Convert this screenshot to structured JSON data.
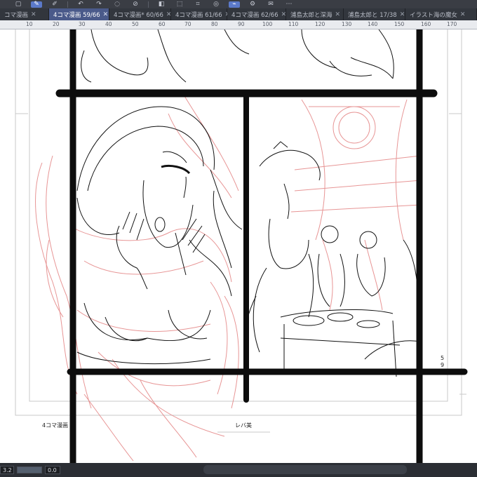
{
  "toolbar": {
    "icons": [
      "select-icon",
      "edit-icon",
      "brush-icon",
      "undo-icon",
      "redo-icon",
      "loading-icon",
      "clear-icon",
      "fill-icon",
      "transform-icon",
      "crop-icon",
      "lasso-icon",
      "deselect-icon",
      "settings-icon",
      "comment-icon",
      "more-icon"
    ]
  },
  "tabs": [
    {
      "label": "コマ漫画",
      "active": false
    },
    {
      "label": "4コマ漫画 59/66",
      "active": true
    },
    {
      "label": "4コマ漫画* 60/66",
      "active": false
    },
    {
      "label": "4コマ漫画 61/66",
      "active": false
    },
    {
      "label": "4コマ漫画 62/66",
      "active": false
    },
    {
      "label": "浦島太郎と深海",
      "active": false
    },
    {
      "label": "浦島太郎と 17/38",
      "active": false
    },
    {
      "label": "イラスト海の魔女",
      "active": false
    }
  ],
  "ruler": {
    "ticks": [
      "10",
      "20",
      "30",
      "40",
      "50",
      "60",
      "70",
      "80",
      "90",
      "100",
      "110",
      "120",
      "130",
      "140",
      "150",
      "160",
      "170"
    ]
  },
  "page": {
    "footer_left": "4コマ漫画",
    "footer_center": "レバ美",
    "page_number_top": "5",
    "page_number_bottom": "9"
  },
  "status": {
    "zoom": "3.2",
    "angle": "0.0"
  },
  "colors": {
    "sketch": "#e58a8a",
    "ink": "#111111",
    "tab_active": "#4a5a8a"
  }
}
